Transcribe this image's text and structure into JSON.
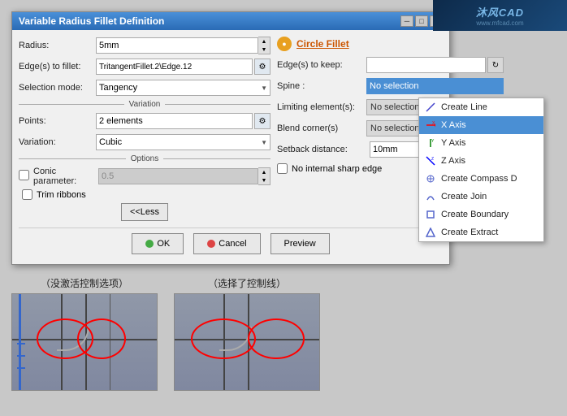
{
  "watermark": {
    "line1": "沐风CAD",
    "line2": "www.mfcad.com"
  },
  "dialog": {
    "title": "Variable Radius Fillet Definition",
    "radius_label": "Radius:",
    "radius_value": "5mm",
    "edges_to_fillet_label": "Edge(s) to fillet:",
    "edges_to_fillet_value": "TritangentFillet.2\\Edge.12",
    "selection_mode_label": "Selection mode:",
    "selection_mode_value": "Tangency",
    "variation_section": "Variation",
    "points_label": "Points:",
    "points_value": "2 elements",
    "variation_label": "Variation:",
    "variation_value": "Cubic",
    "options_section": "Options",
    "conic_param_label": "Conic parameter:",
    "conic_param_value": "0.5",
    "trim_ribbons_label": "Trim ribbons",
    "circle_fillet_label": "Circle Fillet",
    "edges_to_keep_label": "Edge(s) to keep:",
    "no_selection": "No selection",
    "spine_label": "Spine :",
    "limiting_elements_label": "Limiting element(s):",
    "blend_corners_label": "Blend corner(s)",
    "setback_distance_label": "Setback distance:",
    "setback_distance_value": "10mm",
    "no_internal_label": "No internal sharp edge",
    "less_btn": "<<Less",
    "ok_btn": "OK",
    "cancel_btn": "Cancel",
    "preview_btn": "Preview"
  },
  "context_menu": {
    "items": [
      {
        "id": "create-line",
        "label": "Create Line",
        "icon": "line"
      },
      {
        "id": "x-axis",
        "label": "X Axis",
        "icon": "x-axis",
        "active": true
      },
      {
        "id": "y-axis",
        "label": "Y Axis",
        "icon": "y-axis"
      },
      {
        "id": "z-axis",
        "label": "Z Axis",
        "icon": "z-axis"
      },
      {
        "id": "create-compass",
        "label": "Create Compass D",
        "icon": "compass"
      },
      {
        "id": "create-join",
        "label": "Create Join",
        "icon": "join"
      },
      {
        "id": "create-boundary",
        "label": "Create Boundary",
        "icon": "boundary"
      },
      {
        "id": "create-extract",
        "label": "Create Extract",
        "icon": "extract"
      }
    ]
  },
  "bottom": {
    "caption1": "（没激活控制选项）",
    "caption2": "（选择了控制线）"
  }
}
